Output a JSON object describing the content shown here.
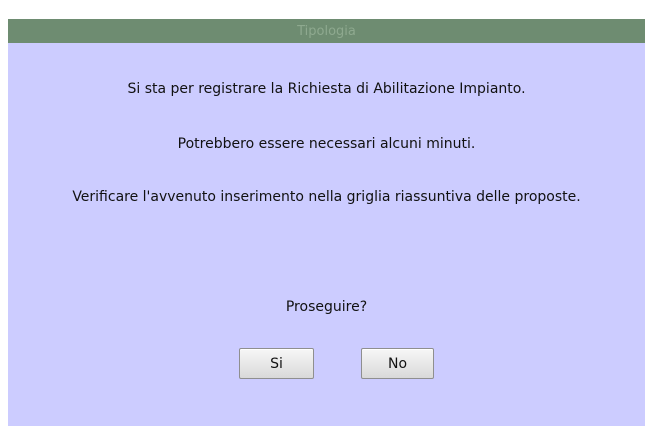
{
  "dialog": {
    "title": "Tipologia",
    "messages": [
      "Si sta per registrare la Richiesta di Abilitazione Impianto.",
      "Potrebbero essere necessari alcuni minuti.",
      "Verificare l'avvenuto inserimento nella griglia riassuntiva delle proposte."
    ],
    "question": "Proseguire?",
    "buttons": {
      "yes_label": "Si",
      "no_label": "No"
    }
  },
  "colors": {
    "title_bar": "#6e8c71",
    "title_text": "#8ea98f",
    "dialog_background": "#ccccff"
  }
}
